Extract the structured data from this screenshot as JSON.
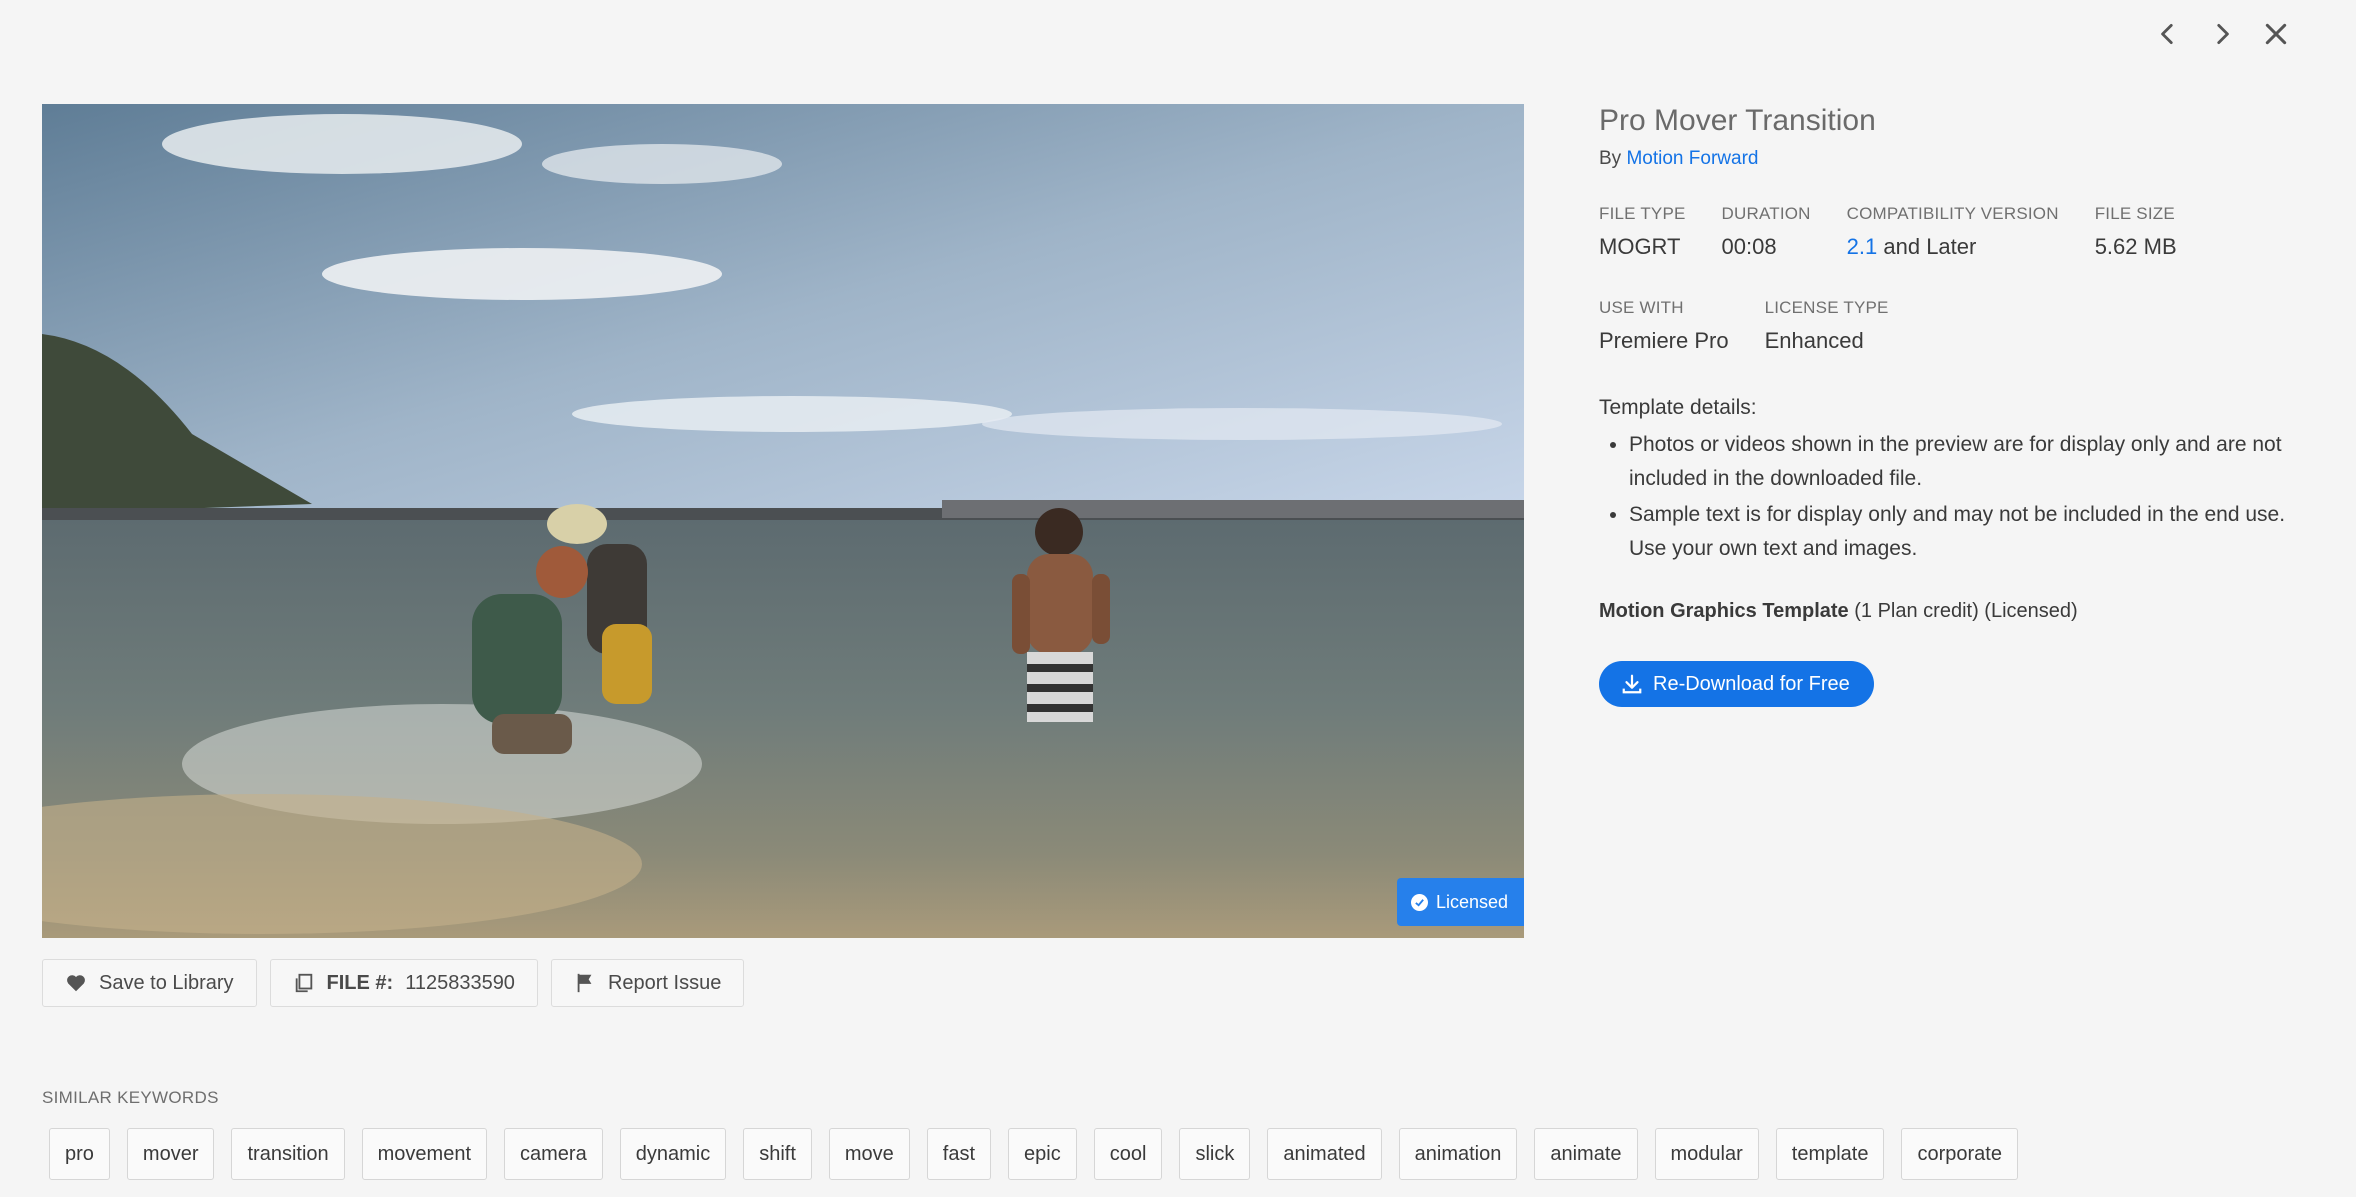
{
  "nav": {
    "prev_icon": "chevron-left-icon",
    "next_icon": "chevron-right-icon",
    "close_icon": "close-icon"
  },
  "preview": {
    "badge_label": "Licensed"
  },
  "actions": {
    "save_label": "Save to Library",
    "file_label": "FILE #:",
    "file_number": "1125833590",
    "report_label": "Report Issue"
  },
  "details": {
    "title": "Pro Mover Transition",
    "by_prefix": "By",
    "author": "Motion Forward",
    "file_type_label": "FILE TYPE",
    "file_type": "MOGRT",
    "duration_label": "DURATION",
    "duration": "00:08",
    "compat_label": "COMPATIBILITY VERSION",
    "compat_version": "2.1",
    "compat_suffix": "and Later",
    "file_size_label": "FILE SIZE",
    "file_size": "5.62 MB",
    "use_with_label": "USE WITH",
    "use_with": "Premiere Pro",
    "license_type_label": "LICENSE TYPE",
    "license_type": "Enhanced",
    "template_details_heading": "Template details:",
    "template_details": [
      "Photos or videos shown in the preview are for display only and are not included in the downloaded file.",
      "Sample text is for display only and may not be included in the end use. Use your own text and images."
    ],
    "credit_bold": "Motion Graphics Template",
    "credit_rest": "(1 Plan credit) (Licensed)",
    "download_label": "Re-Download for Free"
  },
  "keywords_title": "SIMILAR KEYWORDS",
  "keywords": [
    "pro",
    "mover",
    "transition",
    "movement",
    "camera",
    "dynamic",
    "shift",
    "move",
    "fast",
    "epic",
    "cool",
    "slick",
    "animated",
    "animation",
    "animate",
    "modular",
    "template",
    "corporate"
  ],
  "colors": {
    "accent": "#1473e6",
    "badge": "#2680eb",
    "background": "#f5f5f5"
  }
}
